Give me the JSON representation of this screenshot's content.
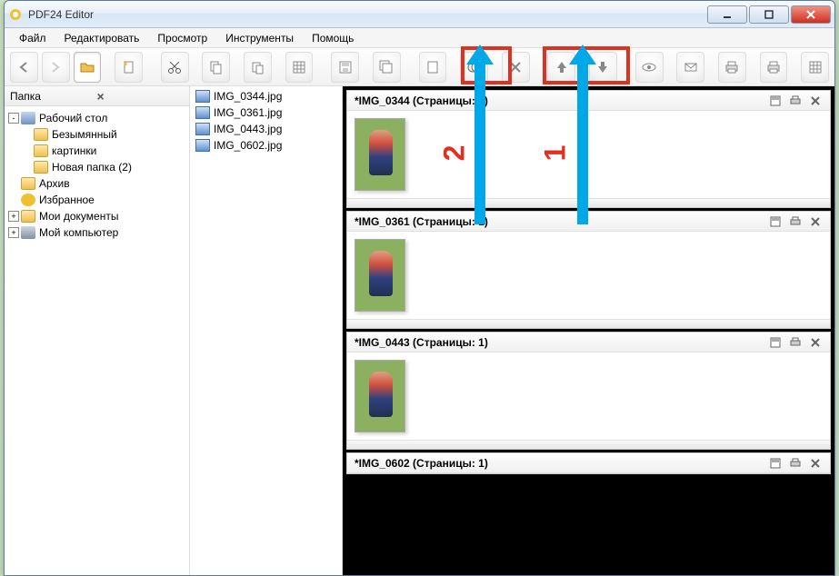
{
  "window": {
    "title": "PDF24 Editor"
  },
  "menubar": [
    "Файл",
    "Редактировать",
    "Просмотр",
    "Инструменты",
    "Помощь"
  ],
  "folder_panel": {
    "title": "Папка",
    "tree": [
      {
        "level": 0,
        "toggle": "-",
        "icon": "desktop",
        "label": "Рабочий стол"
      },
      {
        "level": 1,
        "toggle": "",
        "icon": "folder",
        "label": "Безымянный"
      },
      {
        "level": 1,
        "toggle": "",
        "icon": "folder",
        "label": "картинки"
      },
      {
        "level": 1,
        "toggle": "",
        "icon": "folder",
        "label": "Новая папка (2)"
      },
      {
        "level": 0,
        "toggle": "",
        "icon": "folder",
        "label": "Архив"
      },
      {
        "level": 0,
        "toggle": "",
        "icon": "star",
        "label": "Избранное"
      },
      {
        "level": 0,
        "toggle": "+",
        "icon": "folder",
        "label": "Мои документы"
      },
      {
        "level": 0,
        "toggle": "+",
        "icon": "computer",
        "label": "Мой компьютер"
      }
    ]
  },
  "filelist": [
    "IMG_0344.jpg",
    "IMG_0361.jpg",
    "IMG_0443.jpg",
    "IMG_0602.jpg"
  ],
  "documents": [
    {
      "title": "*IMG_0344 (Страницы: 1)",
      "thumb": true
    },
    {
      "title": "*IMG_0361 (Страницы: 1)",
      "thumb": true
    },
    {
      "title": "*IMG_0443 (Страницы: 1)",
      "thumb": true
    },
    {
      "title": "*IMG_0602 (Страницы: 1)",
      "thumb": false
    }
  ],
  "annotations": {
    "label1": "1",
    "label2": "2"
  }
}
